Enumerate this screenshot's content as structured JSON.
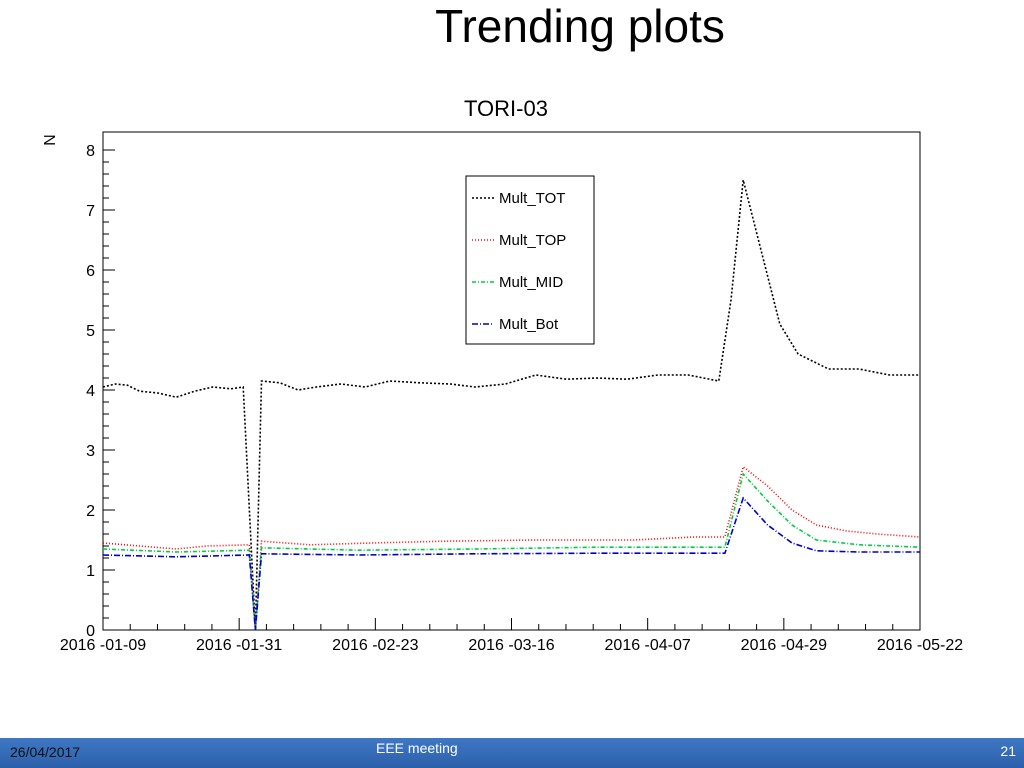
{
  "slide": {
    "title": "Trending plots",
    "footer": {
      "date": "26/04/2017",
      "meeting": "EEE meeting",
      "page": "21"
    }
  },
  "chart_data": {
    "type": "line",
    "title": "TORI-03",
    "xlabel": "",
    "ylabel": "N",
    "ylim": [
      0,
      8.3
    ],
    "grid": false,
    "legend_position": "top-right",
    "xticks": [
      "2016 -01-09",
      "2016 -01-31",
      "2016 -02-23",
      "2016 -03-16",
      "2016 -04-07",
      "2016 -04-29",
      "2016 -05-22"
    ],
    "yticks": [
      "0",
      "1",
      "2",
      "3",
      "4",
      "5",
      "6",
      "7",
      "8"
    ],
    "xlim": [
      "2016-01-09",
      "2016-05-22"
    ],
    "series": [
      {
        "name": "Mult_TOT",
        "color": "#000000",
        "dash": "2,2",
        "points": [
          [
            "2016-01-09",
            4.05
          ],
          [
            "2016-01-11",
            4.1
          ],
          [
            "2016-01-13",
            4.08
          ],
          [
            "2016-01-15",
            3.98
          ],
          [
            "2016-01-18",
            3.95
          ],
          [
            "2016-01-21",
            3.88
          ],
          [
            "2016-01-24",
            3.98
          ],
          [
            "2016-01-27",
            4.05
          ],
          [
            "2016-01-30",
            4.02
          ],
          [
            "2016-02-01",
            4.05
          ],
          [
            "2016-02-03",
            0
          ],
          [
            "2016-02-04",
            4.15
          ],
          [
            "2016-02-07",
            4.12
          ],
          [
            "2016-02-10",
            4.0
          ],
          [
            "2016-02-13",
            4.05
          ],
          [
            "2016-02-17",
            4.1
          ],
          [
            "2016-02-21",
            4.05
          ],
          [
            "2016-02-25",
            4.15
          ],
          [
            "2016-03-01",
            4.12
          ],
          [
            "2016-03-06",
            4.1
          ],
          [
            "2016-03-10",
            4.05
          ],
          [
            "2016-03-15",
            4.1
          ],
          [
            "2016-03-20",
            4.25
          ],
          [
            "2016-03-25",
            4.18
          ],
          [
            "2016-03-30",
            4.2
          ],
          [
            "2016-04-04",
            4.18
          ],
          [
            "2016-04-09",
            4.25
          ],
          [
            "2016-04-14",
            4.25
          ],
          [
            "2016-04-19",
            4.15
          ],
          [
            "2016-04-21",
            5.5
          ],
          [
            "2016-04-23",
            7.5
          ],
          [
            "2016-04-26",
            6.3
          ],
          [
            "2016-04-29",
            5.1
          ],
          [
            "2016-05-02",
            4.6
          ],
          [
            "2016-05-07",
            4.35
          ],
          [
            "2016-05-12",
            4.35
          ],
          [
            "2016-05-17",
            4.25
          ],
          [
            "2016-05-22",
            4.25
          ]
        ]
      },
      {
        "name": "Mult_TOP",
        "color": "#ff0000",
        "dash": "1,2",
        "points": [
          [
            "2016-01-09",
            1.45
          ],
          [
            "2016-01-15",
            1.4
          ],
          [
            "2016-01-21",
            1.35
          ],
          [
            "2016-01-26",
            1.4
          ],
          [
            "2016-02-02",
            1.42
          ],
          [
            "2016-02-03",
            0
          ],
          [
            "2016-02-04",
            1.48
          ],
          [
            "2016-02-12",
            1.42
          ],
          [
            "2016-02-22",
            1.45
          ],
          [
            "2016-03-05",
            1.48
          ],
          [
            "2016-03-20",
            1.5
          ],
          [
            "2016-04-05",
            1.5
          ],
          [
            "2016-04-15",
            1.55
          ],
          [
            "2016-04-20",
            1.55
          ],
          [
            "2016-04-23",
            2.72
          ],
          [
            "2016-04-27",
            2.4
          ],
          [
            "2016-05-01",
            2.0
          ],
          [
            "2016-05-05",
            1.75
          ],
          [
            "2016-05-10",
            1.65
          ],
          [
            "2016-05-15",
            1.6
          ],
          [
            "2016-05-22",
            1.55
          ]
        ]
      },
      {
        "name": "Mult_MID",
        "color": "#00cc44",
        "dash": "4,2,1,2",
        "points": [
          [
            "2016-01-09",
            1.35
          ],
          [
            "2016-01-21",
            1.3
          ],
          [
            "2016-02-02",
            1.33
          ],
          [
            "2016-02-03",
            0
          ],
          [
            "2016-02-04",
            1.37
          ],
          [
            "2016-02-20",
            1.33
          ],
          [
            "2016-03-10",
            1.35
          ],
          [
            "2016-03-30",
            1.38
          ],
          [
            "2016-04-15",
            1.38
          ],
          [
            "2016-04-20",
            1.38
          ],
          [
            "2016-04-23",
            2.6
          ],
          [
            "2016-04-27",
            2.15
          ],
          [
            "2016-05-01",
            1.75
          ],
          [
            "2016-05-05",
            1.5
          ],
          [
            "2016-05-12",
            1.42
          ],
          [
            "2016-05-22",
            1.38
          ]
        ]
      },
      {
        "name": "Mult_Bot",
        "color": "#0000cc",
        "dash": "6,2,1,2",
        "points": [
          [
            "2016-01-09",
            1.25
          ],
          [
            "2016-01-21",
            1.22
          ],
          [
            "2016-02-02",
            1.25
          ],
          [
            "2016-02-03",
            0
          ],
          [
            "2016-02-04",
            1.27
          ],
          [
            "2016-02-20",
            1.25
          ],
          [
            "2016-03-10",
            1.27
          ],
          [
            "2016-03-30",
            1.28
          ],
          [
            "2016-04-15",
            1.28
          ],
          [
            "2016-04-20",
            1.28
          ],
          [
            "2016-04-23",
            2.2
          ],
          [
            "2016-04-27",
            1.75
          ],
          [
            "2016-05-01",
            1.45
          ],
          [
            "2016-05-05",
            1.32
          ],
          [
            "2016-05-12",
            1.3
          ],
          [
            "2016-05-22",
            1.3
          ]
        ]
      }
    ]
  }
}
